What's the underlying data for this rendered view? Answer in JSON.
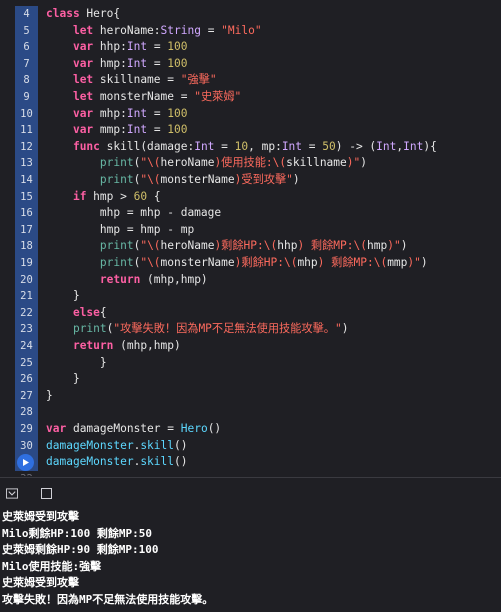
{
  "editor": {
    "lines": [
      {
        "n": "4",
        "tokens": [
          [
            "kw",
            "class "
          ],
          [
            "pl",
            "Hero{"
          ]
        ]
      },
      {
        "n": "5",
        "tokens": [
          [
            "pl",
            "    "
          ],
          [
            "kw",
            "let "
          ],
          [
            "pl",
            "heroName:"
          ],
          [
            "tn",
            "String"
          ],
          [
            "pl",
            " = "
          ],
          [
            "str",
            "\"Milo\""
          ]
        ]
      },
      {
        "n": "6",
        "tokens": [
          [
            "pl",
            "    "
          ],
          [
            "kw",
            "var "
          ],
          [
            "pl",
            "hhp:"
          ],
          [
            "tn",
            "Int"
          ],
          [
            "pl",
            " = "
          ],
          [
            "num",
            "100"
          ]
        ]
      },
      {
        "n": "7",
        "tokens": [
          [
            "pl",
            "    "
          ],
          [
            "kw",
            "var "
          ],
          [
            "pl",
            "hmp:"
          ],
          [
            "tn",
            "Int"
          ],
          [
            "pl",
            " = "
          ],
          [
            "num",
            "100"
          ]
        ]
      },
      {
        "n": "8",
        "tokens": [
          [
            "pl",
            "    "
          ],
          [
            "kw",
            "let "
          ],
          [
            "pl",
            "skillname = "
          ],
          [
            "str",
            "\"強擊\""
          ]
        ]
      },
      {
        "n": "9",
        "tokens": [
          [
            "pl",
            "    "
          ],
          [
            "kw",
            "let "
          ],
          [
            "pl",
            "monsterName = "
          ],
          [
            "str",
            "\"史萊姆\""
          ]
        ]
      },
      {
        "n": "10",
        "tokens": [
          [
            "pl",
            "    "
          ],
          [
            "kw",
            "var "
          ],
          [
            "pl",
            "mhp:"
          ],
          [
            "tn",
            "Int"
          ],
          [
            "pl",
            " = "
          ],
          [
            "num",
            "100"
          ]
        ]
      },
      {
        "n": "11",
        "tokens": [
          [
            "pl",
            "    "
          ],
          [
            "kw",
            "var "
          ],
          [
            "pl",
            "mmp:"
          ],
          [
            "tn",
            "Int"
          ],
          [
            "pl",
            " = "
          ],
          [
            "num",
            "100"
          ]
        ]
      },
      {
        "n": "12",
        "tokens": [
          [
            "pl",
            "    "
          ],
          [
            "kw",
            "func "
          ],
          [
            "pl",
            "skill(damage:"
          ],
          [
            "tn",
            "Int"
          ],
          [
            "pl",
            " = "
          ],
          [
            "num",
            "10"
          ],
          [
            "pl",
            ", mp:"
          ],
          [
            "tn",
            "Int"
          ],
          [
            "pl",
            " = "
          ],
          [
            "num",
            "50"
          ],
          [
            "pl",
            ") -> ("
          ],
          [
            "tn",
            "Int"
          ],
          [
            "pl",
            ","
          ],
          [
            "tn",
            "Int"
          ],
          [
            "pl",
            "){"
          ]
        ]
      },
      {
        "n": "13",
        "tokens": [
          [
            "pl",
            "        "
          ],
          [
            "fn",
            "print"
          ],
          [
            "pl",
            "("
          ],
          [
            "str",
            "\"\\("
          ],
          [
            "pl",
            "heroName"
          ],
          [
            "str",
            ")使用技能:\\("
          ],
          [
            "pl",
            "skillname"
          ],
          [
            "str",
            ")\""
          ],
          [
            "pl",
            ")"
          ]
        ]
      },
      {
        "n": "14",
        "tokens": [
          [
            "pl",
            "        "
          ],
          [
            "fn",
            "print"
          ],
          [
            "pl",
            "("
          ],
          [
            "str",
            "\"\\("
          ],
          [
            "pl",
            "monsterName"
          ],
          [
            "str",
            ")受到攻擊\""
          ],
          [
            "pl",
            ")"
          ]
        ]
      },
      {
        "n": "15",
        "tokens": [
          [
            "pl",
            "    "
          ],
          [
            "kw",
            "if "
          ],
          [
            "pl",
            "hmp > "
          ],
          [
            "num",
            "60"
          ],
          [
            "pl",
            " {"
          ]
        ]
      },
      {
        "n": "16",
        "tokens": [
          [
            "pl",
            "        mhp = mhp - damage"
          ]
        ]
      },
      {
        "n": "17",
        "tokens": [
          [
            "pl",
            "        hmp = hmp - mp"
          ]
        ]
      },
      {
        "n": "18",
        "tokens": [
          [
            "pl",
            "        "
          ],
          [
            "fn",
            "print"
          ],
          [
            "pl",
            "("
          ],
          [
            "str",
            "\"\\("
          ],
          [
            "pl",
            "heroName"
          ],
          [
            "str",
            ")剩餘HP:\\("
          ],
          [
            "pl",
            "hhp"
          ],
          [
            "str",
            ") 剩餘MP:\\("
          ],
          [
            "pl",
            "hmp"
          ],
          [
            "str",
            ")\""
          ],
          [
            "pl",
            ")"
          ]
        ]
      },
      {
        "n": "19",
        "tokens": [
          [
            "pl",
            "        "
          ],
          [
            "fn",
            "print"
          ],
          [
            "pl",
            "("
          ],
          [
            "str",
            "\"\\("
          ],
          [
            "pl",
            "monsterName"
          ],
          [
            "str",
            ")剩餘HP:\\("
          ],
          [
            "pl",
            "mhp"
          ],
          [
            "str",
            ") 剩餘MP:\\("
          ],
          [
            "pl",
            "mmp"
          ],
          [
            "str",
            ")\""
          ],
          [
            "pl",
            ")"
          ]
        ]
      },
      {
        "n": "20",
        "tokens": [
          [
            "pl",
            "        "
          ],
          [
            "kw",
            "return "
          ],
          [
            "pl",
            "(mhp,hmp)"
          ]
        ]
      },
      {
        "n": "21",
        "tokens": [
          [
            "pl",
            "    }"
          ]
        ]
      },
      {
        "n": "22",
        "tokens": [
          [
            "pl",
            "    "
          ],
          [
            "kw",
            "else"
          ],
          [
            "pl",
            "{"
          ]
        ]
      },
      {
        "n": "23",
        "tokens": [
          [
            "pl",
            "    "
          ],
          [
            "fn",
            "print"
          ],
          [
            "pl",
            "("
          ],
          [
            "str",
            "\"攻擊失敗！因為MP不足無法使用技能攻擊。\""
          ],
          [
            "pl",
            ")"
          ]
        ]
      },
      {
        "n": "24",
        "tokens": [
          [
            "pl",
            "    "
          ],
          [
            "kw",
            "return "
          ],
          [
            "pl",
            "(mhp,hmp)"
          ]
        ]
      },
      {
        "n": "25",
        "tokens": [
          [
            "pl",
            "        }"
          ]
        ]
      },
      {
        "n": "26",
        "tokens": [
          [
            "pl",
            "    }"
          ]
        ]
      },
      {
        "n": "27",
        "tokens": [
          [
            "pl",
            "}"
          ]
        ]
      },
      {
        "n": "28",
        "tokens": [
          [
            "pl",
            ""
          ]
        ]
      },
      {
        "n": "29",
        "tokens": [
          [
            "kw",
            "var "
          ],
          [
            "pl",
            "damageMonster = "
          ],
          [
            "ty",
            "Hero"
          ],
          [
            "pl",
            "()"
          ]
        ]
      },
      {
        "n": "30",
        "tokens": [
          [
            "ty",
            "damageMonster"
          ],
          [
            "pl",
            "."
          ],
          [
            "ty",
            "skill"
          ],
          [
            "pl",
            "()"
          ]
        ]
      },
      {
        "n": "31",
        "tokens": [
          [
            "ty",
            "damageMonster"
          ],
          [
            "pl",
            "."
          ],
          [
            "ty",
            "skill"
          ],
          [
            "pl",
            "()"
          ]
        ]
      },
      {
        "n": "32",
        "tokens": [
          [
            "pl",
            ""
          ]
        ]
      }
    ],
    "run_line": "31"
  },
  "console_toolbar": {
    "hide_icon": "hide-debug-area-icon",
    "split_icon": "toggle-console-icon"
  },
  "console": {
    "lines": [
      "史萊姆受到攻擊",
      "Milo剩餘HP:100 剩餘MP:50",
      "史萊姆剩餘HP:90 剩餘MP:100",
      "Milo使用技能:強擊",
      "史萊姆受到攻擊",
      "攻擊失敗！因為MP不足無法使用技能攻擊。"
    ]
  },
  "colors": {
    "background": "#1f1f24",
    "gutter_active": "#2b4a86",
    "keyword": "#fc5fa3",
    "string": "#fc6a5d",
    "number": "#d0bf69",
    "type": "#d0a8ff",
    "user_symbol": "#5dd8ff",
    "run_marker": "#2f6fe0"
  }
}
